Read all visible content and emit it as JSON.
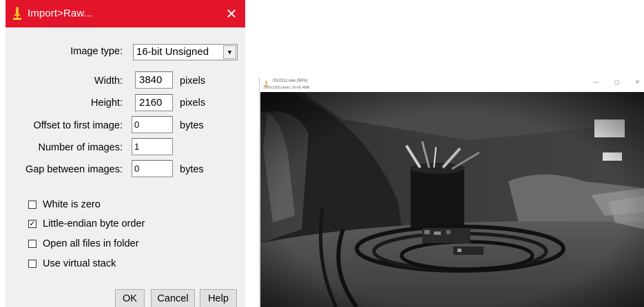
{
  "dialog": {
    "title": "Import>Raw...",
    "close_glyph": "✕",
    "image_type_label": "Image type:",
    "image_type_value": "16-bit Unsigned",
    "width_label": "Width:",
    "width_value": "3840",
    "width_unit": "pixels",
    "height_label": "Height:",
    "height_value": "2160",
    "height_unit": "pixels",
    "offset_label": "Offset to first image:",
    "offset_value": "0",
    "offset_unit": "bytes",
    "num_images_label": "Number of images:",
    "num_images_value": "1",
    "gap_label": "Gap between images:",
    "gap_value": "0",
    "gap_unit": "bytes",
    "checkboxes": [
      {
        "label": "White is zero",
        "checked": false
      },
      {
        "label": "Little-endian byte order",
        "checked": true
      },
      {
        "label": "Open all files in folder",
        "checked": false
      },
      {
        "label": "Use virtual stack",
        "checked": false
      }
    ],
    "buttons": {
      "ok": "OK",
      "cancel": "Cancel",
      "help": "Help"
    },
    "accent_color": "#e3152b"
  },
  "image_window": {
    "title": "OV2311.raw (50%)",
    "subtitle": "1600x1300 pixels; 16-bit; 4MB",
    "controls": {
      "minimize": "—",
      "maximize": "▢",
      "close": "✕"
    }
  },
  "icons": {
    "app": "imagej-microscope-icon",
    "dropdown": "chevron-down-icon",
    "check": "check-icon"
  }
}
